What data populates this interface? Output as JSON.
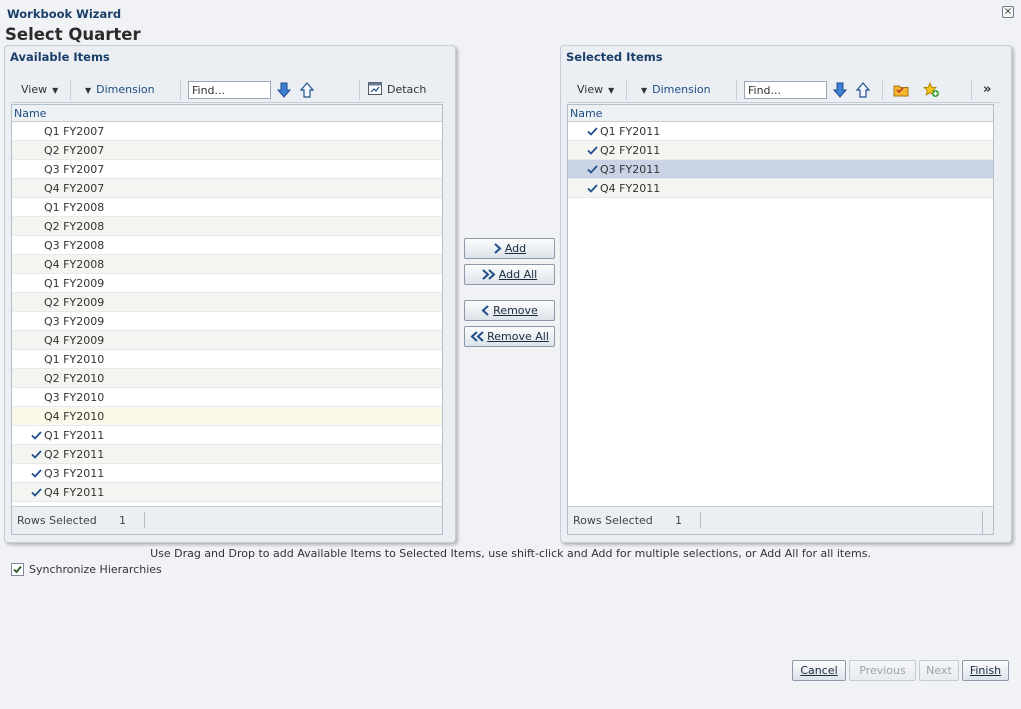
{
  "window": {
    "title": "Workbook Wizard",
    "close_glyph": "×"
  },
  "page": {
    "title": "Select Quarter"
  },
  "available": {
    "header": "Available Items",
    "toolbar": {
      "view_label": "View",
      "dimension_label": "Dimension",
      "find_placeholder": "Find...",
      "detach_label": "Detach"
    },
    "column_name": "Name",
    "items": [
      {
        "label": "Q1 FY2007",
        "checked": false
      },
      {
        "label": "Q2 FY2007",
        "checked": false
      },
      {
        "label": "Q3 FY2007",
        "checked": false
      },
      {
        "label": "Q4 FY2007",
        "checked": false
      },
      {
        "label": "Q1 FY2008",
        "checked": false
      },
      {
        "label": "Q2 FY2008",
        "checked": false
      },
      {
        "label": "Q3 FY2008",
        "checked": false
      },
      {
        "label": "Q4 FY2008",
        "checked": false
      },
      {
        "label": "Q1 FY2009",
        "checked": false
      },
      {
        "label": "Q2 FY2009",
        "checked": false
      },
      {
        "label": "Q3 FY2009",
        "checked": false
      },
      {
        "label": "Q4 FY2009",
        "checked": false
      },
      {
        "label": "Q1 FY2010",
        "checked": false
      },
      {
        "label": "Q2 FY2010",
        "checked": false
      },
      {
        "label": "Q3 FY2010",
        "checked": false
      },
      {
        "label": "Q4 FY2010",
        "checked": false,
        "hover": true
      },
      {
        "label": "Q1 FY2011",
        "checked": true
      },
      {
        "label": "Q2 FY2011",
        "checked": true
      },
      {
        "label": "Q3 FY2011",
        "checked": true
      },
      {
        "label": "Q4 FY2011",
        "checked": true
      }
    ],
    "footer": {
      "rows_selected_label": "Rows Selected",
      "rows_selected_count": "1"
    }
  },
  "shuttle": {
    "add_label": "Add",
    "add_all_label": "Add All",
    "remove_label": "Remove",
    "remove_all_label": "Remove All"
  },
  "selected": {
    "header": "Selected Items",
    "toolbar": {
      "view_label": "View",
      "dimension_label": "Dimension",
      "find_placeholder": "Find...",
      "overflow_glyph": "»"
    },
    "column_name": "Name",
    "items": [
      {
        "label": "Q1 FY2011",
        "checked": true
      },
      {
        "label": "Q2 FY2011",
        "checked": true
      },
      {
        "label": "Q3 FY2011",
        "checked": true,
        "selected": true
      },
      {
        "label": "Q4 FY2011",
        "checked": true
      }
    ],
    "footer": {
      "rows_selected_label": "Rows Selected",
      "rows_selected_count": "1"
    }
  },
  "hint": "Use Drag and Drop to add Available Items to Selected Items, use shift-click and Add for multiple selections, or Add All for all items.",
  "sync": {
    "label": "Synchronize Hierarchies",
    "checked": true
  },
  "footer_buttons": {
    "cancel_label": "Cancel",
    "previous_label": "Previous",
    "next_label": "Next",
    "finish_label": "Finish"
  },
  "colors": {
    "accent": "#1b3f6a",
    "link": "#1e4d82",
    "check": "#1f4f8b",
    "selected_row": "#cad3e3"
  }
}
